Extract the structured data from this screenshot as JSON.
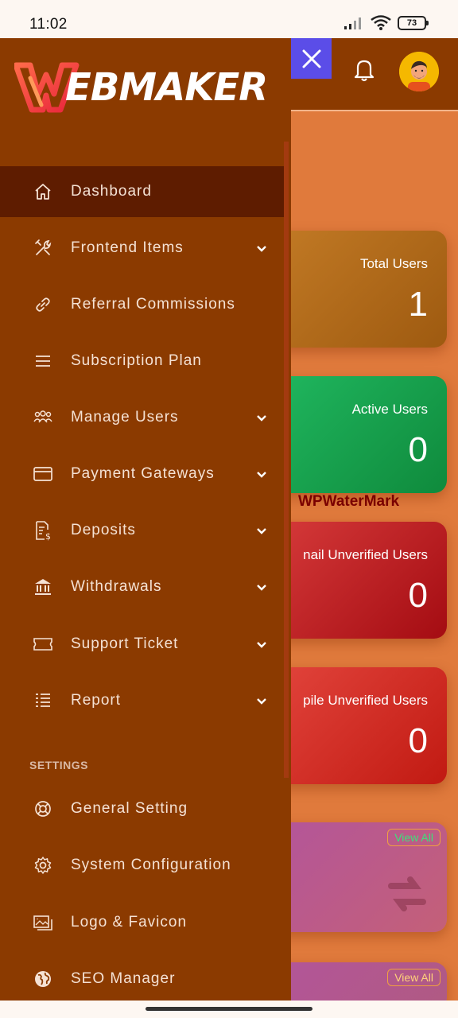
{
  "status_bar": {
    "time": "11:02",
    "battery": "73"
  },
  "header": {
    "close_icon": "close-icon",
    "bell_icon": "bell-icon",
    "avatar": "user-avatar"
  },
  "brand": {
    "logo_text": "EBMAKER",
    "logo_letter": "W"
  },
  "sidebar": {
    "items": [
      {
        "label": "Dashboard",
        "icon": "home-icon",
        "expandable": false,
        "active": true
      },
      {
        "label": "Frontend Items",
        "icon": "tools-icon",
        "expandable": true
      },
      {
        "label": "Referral Commissions",
        "icon": "link-icon",
        "expandable": false
      },
      {
        "label": "Subscription Plan",
        "icon": "menu-lines-icon",
        "expandable": false
      },
      {
        "label": "Manage Users",
        "icon": "users-icon",
        "expandable": true
      },
      {
        "label": "Payment Gateways",
        "icon": "credit-card-icon",
        "expandable": true
      },
      {
        "label": "Deposits",
        "icon": "invoice-dollar-icon",
        "expandable": true
      },
      {
        "label": "Withdrawals",
        "icon": "bank-icon",
        "expandable": true
      },
      {
        "label": "Support Ticket",
        "icon": "ticket-icon",
        "expandable": true
      },
      {
        "label": "Report",
        "icon": "list-icon",
        "expandable": true
      }
    ],
    "settings_label": "SETTINGS",
    "settings_items": [
      {
        "label": "General Setting",
        "icon": "lifebuoy-icon"
      },
      {
        "label": "System Configuration",
        "icon": "gear-icon"
      },
      {
        "label": "Logo & Favicon",
        "icon": "images-icon"
      },
      {
        "label": "SEO Manager",
        "icon": "globe-icon"
      }
    ]
  },
  "dashboard": {
    "cards": [
      {
        "label": "Total Users",
        "value": "1",
        "color": "#b36a1b"
      },
      {
        "label": "Active Users",
        "value": "0",
        "color": "#18a04c"
      },
      {
        "label": "nail Unverified Users",
        "value": "0",
        "color": "#c0262b"
      },
      {
        "label": "pile Unverified Users",
        "value": "0",
        "color": "#d6342c"
      }
    ],
    "view_all_1": "View All",
    "view_all_2": "View All"
  },
  "watermark": "WPWaterMark",
  "colors": {
    "sidebar_bg": "#8b3a00",
    "active_item_bg": "#5e1c00",
    "main_bg": "#e07a3c",
    "close_btn": "#5b4de8"
  }
}
